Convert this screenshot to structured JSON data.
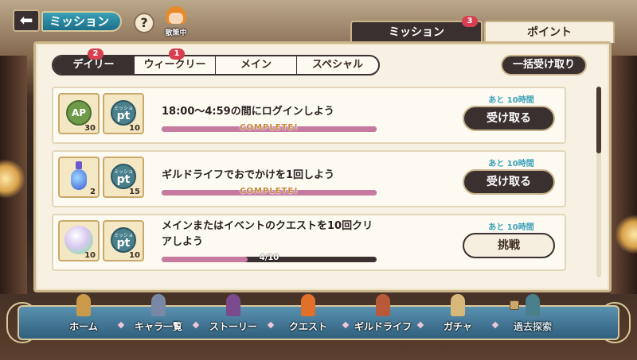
{
  "header": {
    "back_icon": "back-arrow-icon",
    "title": "ミッション",
    "help": "?",
    "character_label": "散策中"
  },
  "top_tabs": [
    {
      "label": "ミッション",
      "badge": "3",
      "active": true
    },
    {
      "label": "ポイント",
      "active": false
    }
  ],
  "filter_tabs": [
    {
      "label": "デイリー",
      "badge": "2",
      "active": true
    },
    {
      "label": "ウィークリー",
      "badge": "1",
      "active": false
    },
    {
      "label": "メイン",
      "active": false
    },
    {
      "label": "スペシャル",
      "active": false
    }
  ],
  "bulk_receive": "一括受け取り",
  "missions": [
    {
      "title": "18:00～4:59の間にログインしよう",
      "rewards": [
        {
          "icon": "ap-icon",
          "label": "AP",
          "qty": "30"
        },
        {
          "icon": "mission-pt-icon",
          "small": "ミッション",
          "label": "pt",
          "qty": "10"
        }
      ],
      "progress_text": "COMPLETE!",
      "progress": 1.0,
      "remaining": "あと 10時間",
      "action": "受け取る"
    },
    {
      "title": "ギルドライフでおでかけを1回しよう",
      "rewards": [
        {
          "icon": "potion-icon",
          "qty": "2"
        },
        {
          "icon": "mission-pt-icon",
          "small": "ミッション",
          "label": "pt",
          "qty": "15"
        }
      ],
      "progress_text": "COMPLETE!",
      "progress": 1.0,
      "remaining": "あと 10時間",
      "action": "受け取る"
    },
    {
      "title_line1": "メインまたはイベントのクエストを10回クリ",
      "title_line2": "アしよう",
      "rewards": [
        {
          "icon": "orb-icon",
          "qty": "10"
        },
        {
          "icon": "mission-pt-icon",
          "small": "ミッション",
          "label": "pt",
          "qty": "10"
        }
      ],
      "progress_text": "4/10",
      "progress": 0.4,
      "remaining": "あと 10時間",
      "action": "挑戦"
    }
  ],
  "nav": [
    {
      "label": "ホーム",
      "color": "#c99a4a"
    },
    {
      "label": "キャラ一覧",
      "color": "#7a88a8"
    },
    {
      "label": "ストーリー",
      "color": "#7a4a8c"
    },
    {
      "label": "クエスト",
      "color": "#e0702a"
    },
    {
      "label": "ギルドライフ",
      "color": "#b85a3a"
    },
    {
      "label": "ガチャ",
      "color": "#d8b87a"
    },
    {
      "label": "過去探索",
      "color": "#4a7f8c",
      "locked": true
    }
  ],
  "colors": {
    "dark": "#3b3030",
    "teal": "#3aa0b8",
    "badge": "#d64050",
    "progress_fill": "#c77aa0",
    "complete": "#c6883a"
  }
}
